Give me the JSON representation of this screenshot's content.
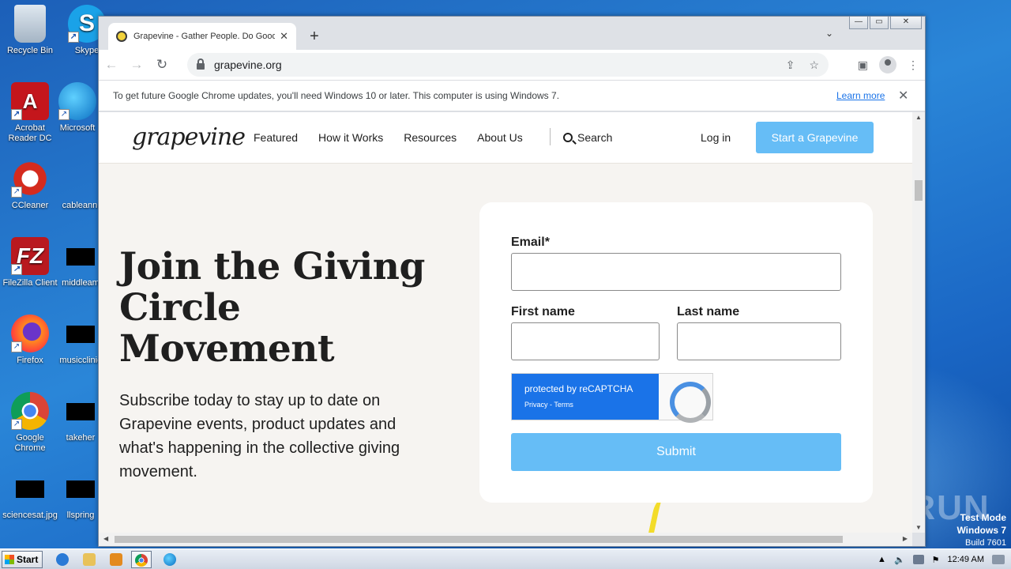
{
  "desktop": {
    "icons": [
      {
        "label": "Recycle Bin",
        "icon": "recycle-bin-icon"
      },
      {
        "label": "Skype",
        "icon": "skype-icon"
      },
      {
        "label": "Acrobat Reader DC",
        "icon": "acrobat-icon"
      },
      {
        "label": "Microsoft",
        "icon": "edge-icon"
      },
      {
        "label": "CCleaner",
        "icon": "ccleaner-icon"
      },
      {
        "label": "cableannu",
        "icon": "file-icon"
      },
      {
        "label": "FileZilla Client",
        "icon": "filezilla-icon"
      },
      {
        "label": "middleam",
        "icon": "file-icon"
      },
      {
        "label": "Firefox",
        "icon": "firefox-icon"
      },
      {
        "label": "musicclinic",
        "icon": "file-icon"
      },
      {
        "label": "Google Chrome",
        "icon": "chrome-icon"
      },
      {
        "label": "takeher",
        "icon": "file-icon"
      },
      {
        "label": "sciencesat.jpg",
        "icon": "image-icon"
      },
      {
        "label": "llspring",
        "icon": "file-icon"
      }
    ]
  },
  "browser": {
    "tab_title": "Grapevine - Gather People. Do Good",
    "url": "grapevine.org",
    "infobar_text": "To get future Google Chrome updates, you'll need Windows 10 or later. This computer is using Windows 7.",
    "infobar_link": "Learn more"
  },
  "site": {
    "logo": "grapevine",
    "nav": [
      "Featured",
      "How it Works",
      "Resources",
      "About Us"
    ],
    "search_label": "Search",
    "login_label": "Log in",
    "cta_label": "Start a Grapevine",
    "hero_title": "Join the Giving Circle Movement",
    "hero_subtitle": "Subscribe today to stay up to date on Grapevine events, product updates and what's happening in the collective giving movement.",
    "form": {
      "email_label": "Email*",
      "first_name_label": "First name",
      "last_name_label": "Last name",
      "recaptcha_text": "protected by reCAPTCHA",
      "recaptcha_links": "Privacy - Terms",
      "submit_label": "Submit"
    }
  },
  "watermark": {
    "brand": "ANY RUN",
    "test_mode": "Test Mode",
    "os": "Windows 7",
    "build": "Build 7601"
  },
  "taskbar": {
    "start_label": "Start",
    "clock": "12:49 AM"
  },
  "colors": {
    "accent_button": "#66bdf6",
    "page_bg": "#f6f4f1"
  }
}
